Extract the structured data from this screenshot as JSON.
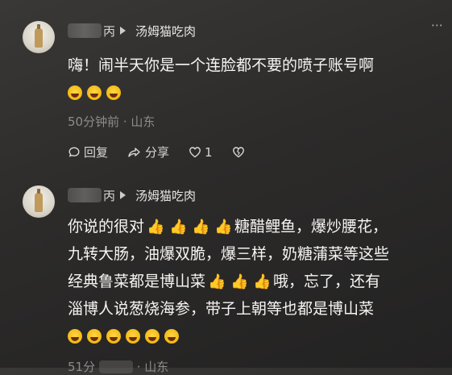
{
  "comments": [
    {
      "name_suffix": "丙",
      "target": "汤姆猫吃肉",
      "more": "⋯",
      "line1": "嗨！闹半天你是一个连脸都不要的喷子账号啊",
      "meta": "50分钟前 · 山东",
      "actions": {
        "reply": "回复",
        "share": "分享",
        "likes": "1"
      }
    },
    {
      "name_suffix": "丙",
      "target": "汤姆猫吃肉",
      "line1_a": "你说的很对",
      "line1_b": "糖醋鲤鱼，爆炒腰花，",
      "line2": "九转大肠，油爆双脆，爆三样，奶糖蒲菜等这些",
      "line3_a": "经典鲁菜都是博山菜",
      "line3_b": "哦，忘了，还有",
      "line4": "淄博人说葱烧海参，带子上朝等也都是博山菜",
      "meta_start": "51分",
      "meta_end": "· 山东"
    }
  ],
  "icons": {
    "laugh_cry": "laugh-cry-emoji",
    "thumbs_up": "thumbs-up-emoji"
  }
}
